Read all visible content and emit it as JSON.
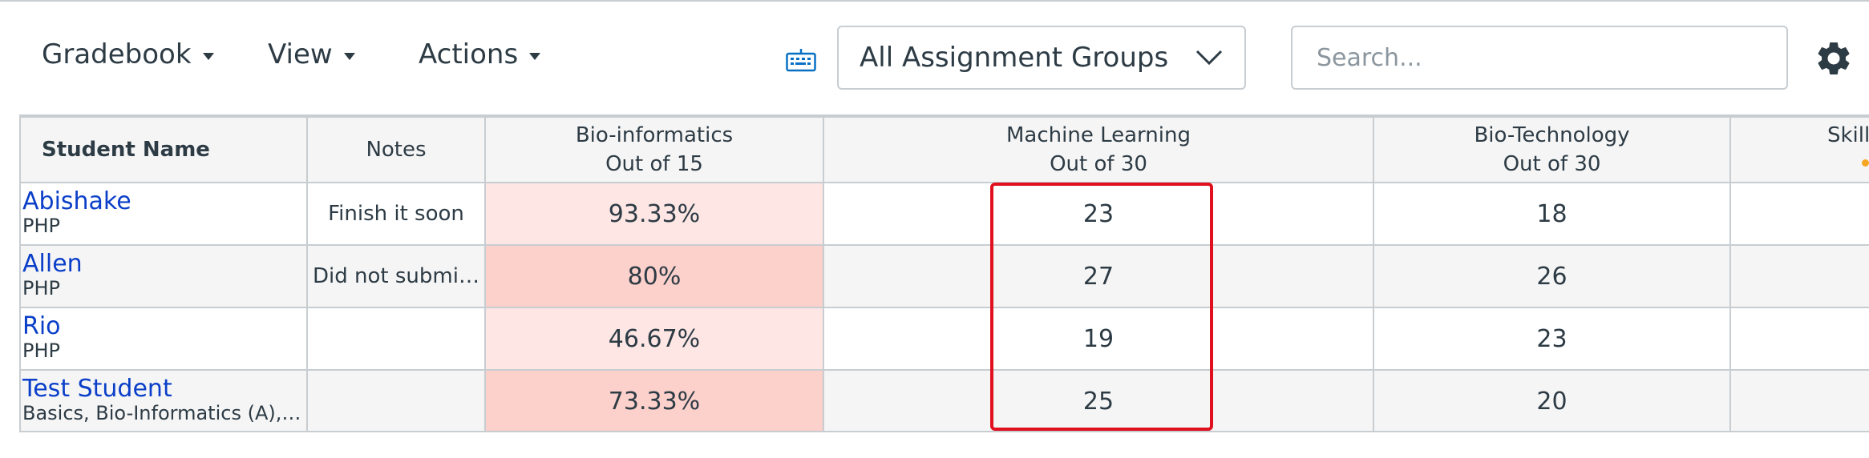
{
  "toolbar": {
    "gradebook_label": "Gradebook",
    "view_label": "View",
    "actions_label": "Actions",
    "assignment_groups_selected": "All Assignment Groups",
    "search_placeholder": "Search..."
  },
  "icons": {
    "keyboard": "keyboard-icon",
    "chevron": "chevron-down-icon",
    "settings": "gear-icon"
  },
  "colors": {
    "link": "#0b3fc9",
    "highlight": "#e0101e",
    "low_score_light": "#fde6e4",
    "low_score_dark": "#fcd0cb"
  },
  "grid": {
    "headers": {
      "student": "Student Name",
      "notes": "Notes",
      "col1_name": "Bio-informatics",
      "col1_points": "Out of 15",
      "col2_name": "Machine Learning",
      "col2_points": "Out of 30",
      "col3_name": "Bio-Technology",
      "col3_points": "Out of 30",
      "col4_name": "Skill"
    },
    "rows": [
      {
        "name": "Abishake",
        "sections": "PHP",
        "notes": "Finish it soon",
        "bio_informatics": "93.33%",
        "machine_learning": "23",
        "bio_technology": "18"
      },
      {
        "name": "Allen",
        "sections": "PHP",
        "notes": "Did not submit a…",
        "bio_informatics": "80%",
        "machine_learning": "27",
        "bio_technology": "26"
      },
      {
        "name": "Rio",
        "sections": "PHP",
        "notes": "",
        "bio_informatics": "46.67%",
        "machine_learning": "19",
        "bio_technology": "23"
      },
      {
        "name": "Test Student",
        "sections": "Basics, Bio-Informatics (A), B…",
        "notes": "",
        "bio_informatics": "73.33%",
        "machine_learning": "25",
        "bio_technology": "20"
      }
    ]
  }
}
